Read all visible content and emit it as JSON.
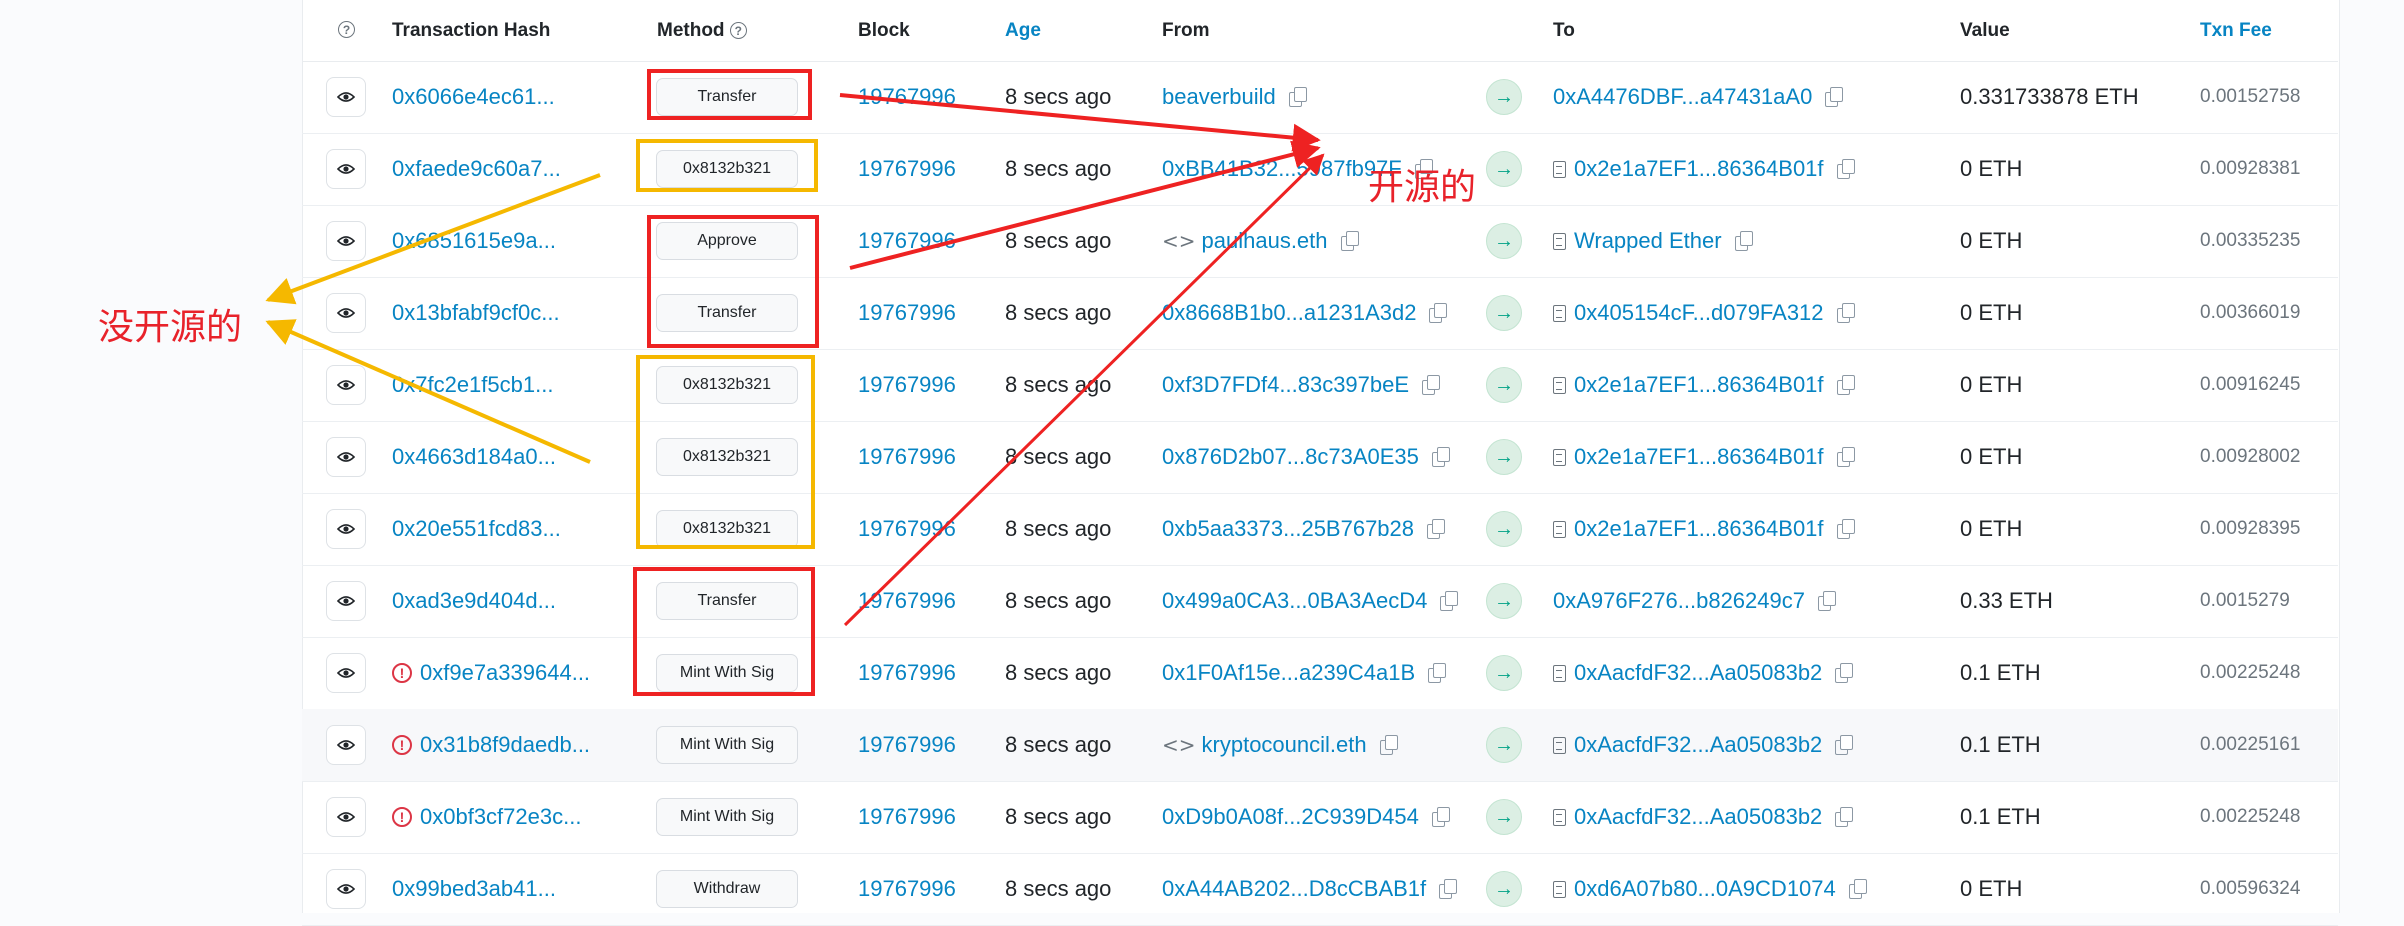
{
  "header": {
    "info_icon": "info-circle-icon",
    "tx_hash": "Transaction Hash",
    "method": "Method",
    "block": "Block",
    "age": "Age",
    "from": "From",
    "to": "To",
    "value": "Value",
    "fee": "Txn Fee"
  },
  "rows": [
    {
      "hash": "0x6066e4ec61...",
      "error": false,
      "method": "Transfer",
      "block": "19767996",
      "age": "8 secs ago",
      "from": "beaverbuild",
      "from_icon": "",
      "to": "0xA4476DBF...a47431aA0",
      "to_contract": false,
      "value": "0.331733878 ETH",
      "fee": "0.00152758"
    },
    {
      "hash": "0xfaede9c60a7...",
      "error": false,
      "method": "0x8132b321",
      "block": "19767996",
      "age": "8 secs ago",
      "from": "0xBB41B32...5987fb97F",
      "from_icon": "",
      "to": "0x2e1a7EF1...86364B01f",
      "to_contract": true,
      "value": "0 ETH",
      "fee": "0.00928381"
    },
    {
      "hash": "0x6851615e9a...",
      "error": false,
      "method": "Approve",
      "block": "19767996",
      "age": "8 secs ago",
      "from": "paulhaus.eth",
      "from_icon": "code",
      "to": "Wrapped Ether",
      "to_contract": true,
      "value": "0 ETH",
      "fee": "0.00335235"
    },
    {
      "hash": "0x13bfabf9cf0c...",
      "error": false,
      "method": "Transfer",
      "block": "19767996",
      "age": "8 secs ago",
      "from": "0x8668B1b0...a1231A3d2",
      "from_icon": "",
      "to": "0x405154cF...d079FA312",
      "to_contract": true,
      "value": "0 ETH",
      "fee": "0.00366019"
    },
    {
      "hash": "0x7fc2e1f5cb1...",
      "error": false,
      "method": "0x8132b321",
      "block": "19767996",
      "age": "8 secs ago",
      "from": "0xf3D7FDf4...83c397beE",
      "from_icon": "",
      "to": "0x2e1a7EF1...86364B01f",
      "to_contract": true,
      "value": "0 ETH",
      "fee": "0.00916245"
    },
    {
      "hash": "0x4663d184a0...",
      "error": false,
      "method": "0x8132b321",
      "block": "19767996",
      "age": "8 secs ago",
      "from": "0x876D2b07...8c73A0E35",
      "from_icon": "",
      "to": "0x2e1a7EF1...86364B01f",
      "to_contract": true,
      "value": "0 ETH",
      "fee": "0.00928002"
    },
    {
      "hash": "0x20e551fcd83...",
      "error": false,
      "method": "0x8132b321",
      "block": "19767996",
      "age": "8 secs ago",
      "from": "0xb5aa3373...25B767b28",
      "from_icon": "",
      "to": "0x2e1a7EF1...86364B01f",
      "to_contract": true,
      "value": "0 ETH",
      "fee": "0.00928395"
    },
    {
      "hash": "0xad3e9d404d...",
      "error": false,
      "method": "Transfer",
      "block": "19767996",
      "age": "8 secs ago",
      "from": "0x499a0CA3...0BA3AecD4",
      "from_icon": "",
      "to": "0xA976F276...b826249c7",
      "to_contract": false,
      "value": "0.33 ETH",
      "fee": "0.0015279"
    },
    {
      "hash": "0xf9e7a339644...",
      "error": true,
      "method": "Mint With Sig",
      "block": "19767996",
      "age": "8 secs ago",
      "from": "0x1F0Af15e...a239C4a1B",
      "from_icon": "",
      "to": "0xAacfdF32...Aa05083b2",
      "to_contract": true,
      "value": "0.1 ETH",
      "fee": "0.00225248"
    },
    {
      "hash": "0x31b8f9daedb...",
      "error": true,
      "method": "Mint With Sig",
      "block": "19767996",
      "age": "8 secs ago",
      "from": "kryptocouncil.eth",
      "from_icon": "code",
      "to": "0xAacfdF32...Aa05083b2",
      "to_contract": true,
      "value": "0.1 ETH",
      "fee": "0.00225161"
    },
    {
      "hash": "0x0bf3cf72e3c...",
      "error": true,
      "method": "Mint With Sig",
      "block": "19767996",
      "age": "8 secs ago",
      "from": "0xD9b0A08f...2C939D454",
      "from_icon": "",
      "to": "0xAacfdF32...Aa05083b2",
      "to_contract": true,
      "value": "0.1 ETH",
      "fee": "0.00225248"
    },
    {
      "hash": "0x99bed3ab41...",
      "error": false,
      "method": "Withdraw",
      "block": "19767996",
      "age": "8 secs ago",
      "from": "0xA44AB202...D8cCBAB1f",
      "from_icon": "",
      "to": "0xd6A07b80...0A9CD1074",
      "to_contract": true,
      "value": "0 ETH",
      "fee": "0.00596324"
    }
  ],
  "icons": {
    "eye": "eye-icon",
    "copy": "copy-icon",
    "direction": "arrow-right-icon",
    "contract": "contract-file-icon",
    "code": "code-icon",
    "error": "error-icon"
  },
  "annotations": {
    "open_source": "开源的",
    "not_open_source": "没开源的",
    "open_source_color": "#e8222a",
    "not_open_source_color": "#f5b800"
  }
}
